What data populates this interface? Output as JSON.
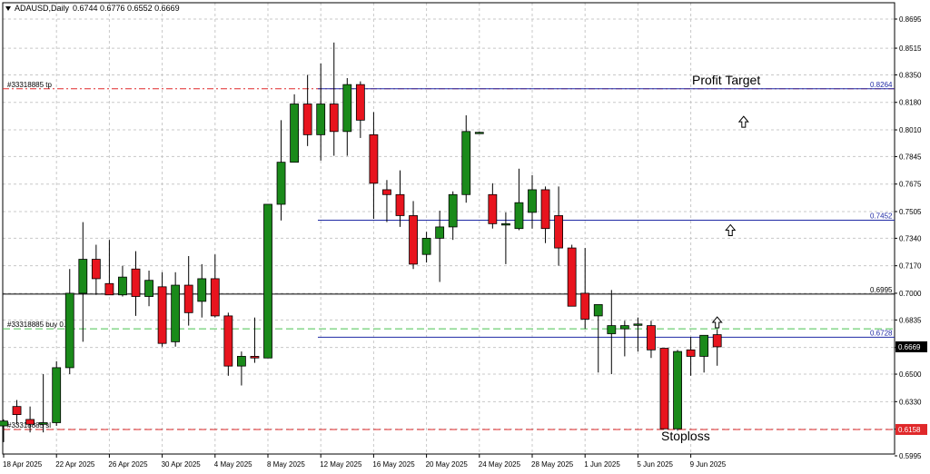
{
  "header": {
    "title": "ADAUSD,Daily",
    "ohlc": "0.6744 0.6776 0.6552 0.6669"
  },
  "annotations": {
    "profit_target": "Profit Target",
    "stoploss": "Stoploss",
    "tp_label": "#33318885 tp",
    "buy_label": "#33318885 buy 0.50",
    "sl_label": "#33318885 sl"
  },
  "colors": {
    "bull": "#1a8a1a",
    "bear": "#e8141e",
    "blue_line": "#1f2aa5",
    "tp_sl_line": "#e0282a",
    "buy_line": "#49c24f",
    "grid": "#c8c8c8"
  },
  "chart_data": {
    "type": "candlestick",
    "symbol": "ADAUSD",
    "timeframe": "Daily",
    "ylim": [
      0.5995,
      0.8695
    ],
    "y_ticks": [
      "0.8695",
      "0.8515",
      "0.8350",
      "0.8180",
      "0.8010",
      "0.7845",
      "0.7675",
      "0.7505",
      "0.7340",
      "0.7170",
      "0.7000",
      "0.6835",
      "0.6665",
      "0.6500",
      "0.6330",
      "0.6160",
      "0.5995"
    ],
    "x_ticks": [
      {
        "index": 0,
        "label": "18 Apr 2025"
      },
      {
        "index": 4,
        "label": "22 Apr 2025"
      },
      {
        "index": 8,
        "label": "26 Apr 2025"
      },
      {
        "index": 12,
        "label": "30 Apr 2025"
      },
      {
        "index": 16,
        "label": "4 May 2025"
      },
      {
        "index": 20,
        "label": "8 May 2025"
      },
      {
        "index": 24,
        "label": "12 May 2025"
      },
      {
        "index": 28,
        "label": "16 May 2025"
      },
      {
        "index": 32,
        "label": "20 May 2025"
      },
      {
        "index": 36,
        "label": "24 May 2025"
      },
      {
        "index": 40,
        "label": "28 May 2025"
      },
      {
        "index": 44,
        "label": "1 Jun 2025"
      },
      {
        "index": 48,
        "label": "5 Jun 2025"
      },
      {
        "index": 52,
        "label": "9 Jun 2025"
      }
    ],
    "candles": [
      {
        "o": 0.618,
        "h": 0.622,
        "l": 0.608,
        "c": 0.621
      },
      {
        "o": 0.63,
        "h": 0.634,
        "l": 0.619,
        "c": 0.625
      },
      {
        "o": 0.622,
        "h": 0.63,
        "l": 0.614,
        "c": 0.619
      },
      {
        "o": 0.619,
        "h": 0.65,
        "l": 0.614,
        "c": 0.62
      },
      {
        "o": 0.62,
        "h": 0.658,
        "l": 0.618,
        "c": 0.654
      },
      {
        "o": 0.654,
        "h": 0.715,
        "l": 0.65,
        "c": 0.7
      },
      {
        "o": 0.7,
        "h": 0.744,
        "l": 0.67,
        "c": 0.721
      },
      {
        "o": 0.721,
        "h": 0.73,
        "l": 0.699,
        "c": 0.709
      },
      {
        "o": 0.706,
        "h": 0.733,
        "l": 0.699,
        "c": 0.699
      },
      {
        "o": 0.699,
        "h": 0.717,
        "l": 0.698,
        "c": 0.71
      },
      {
        "o": 0.715,
        "h": 0.726,
        "l": 0.686,
        "c": 0.698
      },
      {
        "o": 0.698,
        "h": 0.714,
        "l": 0.692,
        "c": 0.708
      },
      {
        "o": 0.704,
        "h": 0.713,
        "l": 0.667,
        "c": 0.669
      },
      {
        "o": 0.67,
        "h": 0.713,
        "l": 0.667,
        "c": 0.705
      },
      {
        "o": 0.705,
        "h": 0.723,
        "l": 0.68,
        "c": 0.688
      },
      {
        "o": 0.695,
        "h": 0.718,
        "l": 0.685,
        "c": 0.709
      },
      {
        "o": 0.709,
        "h": 0.724,
        "l": 0.685,
        "c": 0.686
      },
      {
        "o": 0.686,
        "h": 0.688,
        "l": 0.649,
        "c": 0.655
      },
      {
        "o": 0.655,
        "h": 0.664,
        "l": 0.643,
        "c": 0.661
      },
      {
        "o": 0.661,
        "h": 0.685,
        "l": 0.657,
        "c": 0.66
      },
      {
        "o": 0.66,
        "h": 0.755,
        "l": 0.66,
        "c": 0.755
      },
      {
        "o": 0.755,
        "h": 0.807,
        "l": 0.745,
        "c": 0.781
      },
      {
        "o": 0.781,
        "h": 0.823,
        "l": 0.781,
        "c": 0.817
      },
      {
        "o": 0.817,
        "h": 0.835,
        "l": 0.791,
        "c": 0.798
      },
      {
        "o": 0.798,
        "h": 0.842,
        "l": 0.782,
        "c": 0.817
      },
      {
        "o": 0.817,
        "h": 0.855,
        "l": 0.785,
        "c": 0.8
      },
      {
        "o": 0.8,
        "h": 0.833,
        "l": 0.785,
        "c": 0.829
      },
      {
        "o": 0.829,
        "h": 0.831,
        "l": 0.796,
        "c": 0.807
      },
      {
        "o": 0.798,
        "h": 0.812,
        "l": 0.746,
        "c": 0.768
      },
      {
        "o": 0.764,
        "h": 0.77,
        "l": 0.744,
        "c": 0.761
      },
      {
        "o": 0.761,
        "h": 0.776,
        "l": 0.741,
        "c": 0.748
      },
      {
        "o": 0.748,
        "h": 0.757,
        "l": 0.715,
        "c": 0.718
      },
      {
        "o": 0.724,
        "h": 0.738,
        "l": 0.719,
        "c": 0.734
      },
      {
        "o": 0.734,
        "h": 0.751,
        "l": 0.707,
        "c": 0.741
      },
      {
        "o": 0.741,
        "h": 0.763,
        "l": 0.733,
        "c": 0.761
      },
      {
        "o": 0.761,
        "h": 0.81,
        "l": 0.756,
        "c": 0.8
      },
      {
        "o": 0.799,
        "h": 0.8,
        "l": 0.7985,
        "c": 0.7995
      },
      {
        "o": 0.761,
        "h": 0.768,
        "l": 0.74,
        "c": 0.743
      },
      {
        "o": 0.743,
        "h": 0.75,
        "l": 0.718,
        "c": 0.743
      },
      {
        "o": 0.74,
        "h": 0.777,
        "l": 0.739,
        "c": 0.756
      },
      {
        "o": 0.75,
        "h": 0.773,
        "l": 0.74,
        "c": 0.764
      },
      {
        "o": 0.764,
        "h": 0.766,
        "l": 0.731,
        "c": 0.74
      },
      {
        "o": 0.748,
        "h": 0.766,
        "l": 0.717,
        "c": 0.728
      },
      {
        "o": 0.728,
        "h": 0.73,
        "l": 0.698,
        "c": 0.692
      },
      {
        "o": 0.7,
        "h": 0.728,
        "l": 0.678,
        "c": 0.684
      },
      {
        "o": 0.686,
        "h": 0.691,
        "l": 0.651,
        "c": 0.693
      },
      {
        "o": 0.675,
        "h": 0.702,
        "l": 0.65,
        "c": 0.68
      },
      {
        "o": 0.678,
        "h": 0.683,
        "l": 0.661,
        "c": 0.68
      },
      {
        "o": 0.681,
        "h": 0.685,
        "l": 0.664,
        "c": 0.681
      },
      {
        "o": 0.68,
        "h": 0.683,
        "l": 0.66,
        "c": 0.665
      },
      {
        "o": 0.666,
        "h": 0.665,
        "l": 0.6162,
        "c": 0.6162
      },
      {
        "o": 0.6162,
        "h": 0.665,
        "l": 0.615,
        "c": 0.664
      },
      {
        "o": 0.665,
        "h": 0.673,
        "l": 0.649,
        "c": 0.661
      },
      {
        "o": 0.661,
        "h": 0.673,
        "l": 0.651,
        "c": 0.674
      },
      {
        "o": 0.6744,
        "h": 0.6776,
        "l": 0.6552,
        "c": 0.6669
      }
    ],
    "levels": [
      {
        "name": "tp",
        "label": "#33318885 tp",
        "price": 0.8264,
        "style": "tp"
      },
      {
        "name": "line-7452",
        "price": 0.7452,
        "style": "blue"
      },
      {
        "name": "line-6995",
        "price": 0.6995,
        "style": "black"
      },
      {
        "name": "buy",
        "label": "#33318885 buy 0.50",
        "price": 0.678,
        "style": "buy"
      },
      {
        "name": "line-6728",
        "price": 0.6728,
        "style": "blue"
      },
      {
        "name": "sl",
        "label": "#33318885 sl",
        "price": 0.6158,
        "style": "sl"
      }
    ],
    "price_tags": [
      {
        "text": "0.8264",
        "price": 0.8264,
        "kind": "blue-text"
      },
      {
        "text": "0.7452",
        "price": 0.7452,
        "kind": "blue-text"
      },
      {
        "text": "0.6995",
        "price": 0.6995,
        "kind": "black-text"
      },
      {
        "text": "0.6728",
        "price": 0.6728,
        "kind": "blue-text"
      },
      {
        "text": "0.6669",
        "price": 0.6669,
        "kind": "black-box"
      },
      {
        "text": "0.6158",
        "price": 0.6158,
        "kind": "red-box"
      }
    ],
    "arrows": [
      {
        "index": 56,
        "price": 0.806
      },
      {
        "index": 55,
        "price": 0.739
      },
      {
        "index": 54,
        "price": 0.682
      }
    ]
  }
}
